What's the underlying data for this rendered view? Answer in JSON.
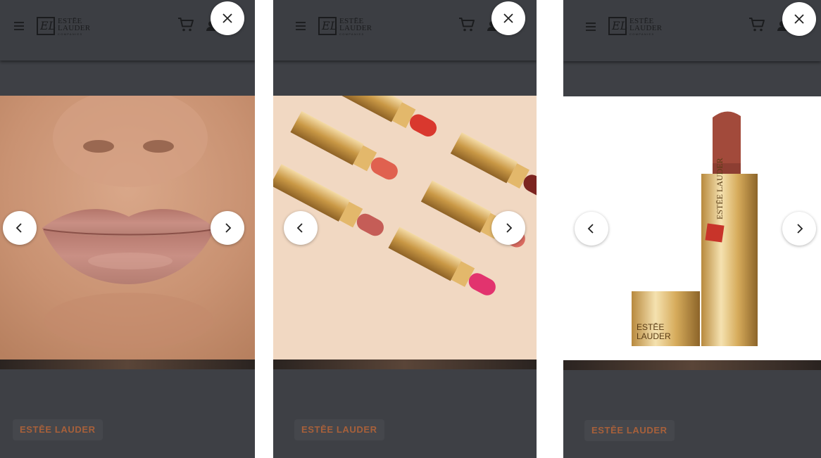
{
  "brand": {
    "logo_line1": "ESTĒE",
    "logo_line2": "LAUDER",
    "logo_line3": "COMPANIES",
    "monogram": "EL"
  },
  "icons": {
    "menu": "hamburger-menu-icon",
    "cart": "shopping-cart-icon",
    "account": "user-account-icon",
    "close": "close-icon",
    "prev": "chevron-left-icon",
    "next": "chevron-right-icon"
  },
  "panels": [
    {
      "image": "Close-up of lips wearing a nude pink lipstick",
      "brand_tag": "ESTĒE LAUDER"
    },
    {
      "image": "Several open gold lipsticks in red, coral and pink shades on a beige background",
      "brand_tag": "ESTĒE LAUDER"
    },
    {
      "image": "Gold lipstick tube with a brick-red bullet next to its cap",
      "brand_tag": "ESTĒE LAUDER",
      "product_text_1": "ESTĒE LAUDER",
      "product_text_2": "ESTĒE",
      "product_text_3": "LAUDER"
    }
  ],
  "colors": {
    "overlay": "#3e4045",
    "brand_tag_text": "#a7603a",
    "button_bg": "#ffffff"
  }
}
